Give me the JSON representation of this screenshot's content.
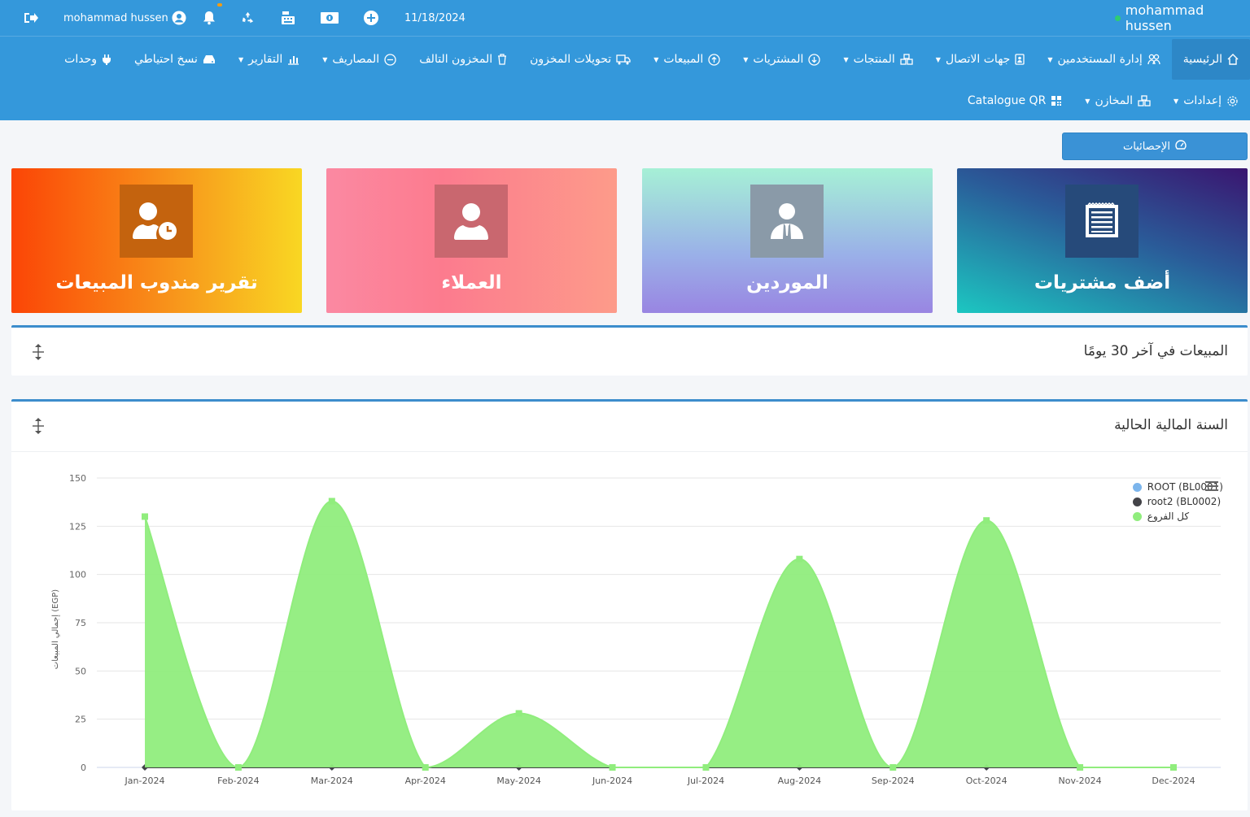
{
  "topbar": {
    "user_name": "mohammad hussen",
    "date": "11/18/2024",
    "right_user": "mohammad hussen"
  },
  "nav": {
    "row1": [
      {
        "id": "home",
        "label": "الرئيسية",
        "icon": "home-icon",
        "active": true,
        "caret": false
      },
      {
        "id": "users",
        "label": "إدارة المستخدمين",
        "icon": "users-icon",
        "caret": true
      },
      {
        "id": "contacts",
        "label": "جهات الاتصال",
        "icon": "address-book-icon",
        "caret": true
      },
      {
        "id": "products",
        "label": "المنتجات",
        "icon": "cubes-icon",
        "caret": true
      },
      {
        "id": "purchases",
        "label": "المشتريات",
        "icon": "arrow-circle-down-icon",
        "caret": true
      },
      {
        "id": "sales",
        "label": "المبيعات",
        "icon": "arrow-circle-up-icon",
        "caret": true
      },
      {
        "id": "stock-transfers",
        "label": "تحويلات المخزون",
        "icon": "truck-icon",
        "caret": false
      },
      {
        "id": "damaged-stock",
        "label": "المخزون التالف",
        "icon": "trash-icon",
        "caret": false
      },
      {
        "id": "expenses",
        "label": "المصاريف",
        "icon": "minus-circle-icon",
        "caret": true
      },
      {
        "id": "reports",
        "label": "التقارير",
        "icon": "bar-chart-icon",
        "caret": true
      },
      {
        "id": "backup",
        "label": "نسخ احتياطي",
        "icon": "hdd-icon",
        "caret": false
      },
      {
        "id": "modules",
        "label": "وحدات",
        "icon": "plug-icon",
        "caret": false
      }
    ],
    "row2": [
      {
        "id": "settings",
        "label": "إعدادات",
        "icon": "gear-icon",
        "caret": true
      },
      {
        "id": "warehouses",
        "label": "المخازن",
        "icon": "cubes-icon",
        "caret": true
      },
      {
        "id": "catalogue-qr",
        "label": "Catalogue QR",
        "icon": "qrcode-icon",
        "caret": false
      }
    ]
  },
  "stats_button": "الإحصائيات",
  "cards": {
    "add_purchase": "أضف مشتريات",
    "suppliers": "الموردين",
    "customers": "العملاء",
    "sales_agent_report": "تقرير مندوب المبيعات"
  },
  "panels": {
    "last30_title": "المبيعات في آخر 30 يومًا",
    "fy_title": "السنة المالية الحالية"
  },
  "chart_data": {
    "type": "area",
    "categories": [
      "Jan-2024",
      "Feb-2024",
      "Mar-2024",
      "Apr-2024",
      "May-2024",
      "Jun-2024",
      "Jul-2024",
      "Aug-2024",
      "Sep-2024",
      "Oct-2024",
      "Nov-2024",
      "Dec-2024"
    ],
    "ylabel": "إجمالي المبيعات (EGP)",
    "ylim": [
      0,
      150
    ],
    "yticks": [
      0,
      25,
      50,
      75,
      100,
      125,
      150
    ],
    "grid": true,
    "legend_position": "top-right",
    "series": [
      {
        "name": "ROOT (BL0001)",
        "color": "#7cb5ec",
        "values": [
          0,
          0,
          0,
          0,
          0,
          0,
          0,
          0,
          0,
          0,
          0,
          0
        ]
      },
      {
        "name": "root2 (BL0002)",
        "color": "#434348",
        "values": [
          0,
          0,
          0,
          0,
          0,
          0,
          0,
          0,
          0,
          0,
          0,
          0
        ]
      },
      {
        "name": "كل الفروع",
        "color": "#90ed7d",
        "values": [
          130,
          0,
          138,
          0,
          28,
          0,
          0,
          108,
          0,
          128,
          0,
          0
        ]
      }
    ]
  }
}
